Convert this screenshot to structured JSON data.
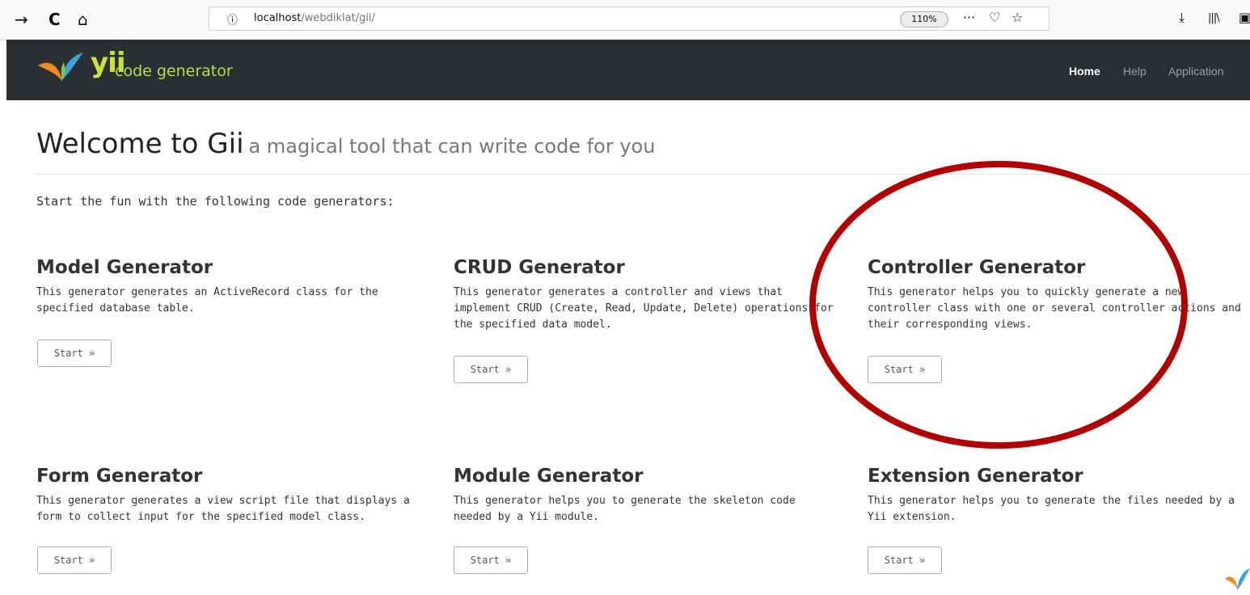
{
  "browser": {
    "back_icon": "→",
    "reload_icon": "C",
    "home_icon": "⌂",
    "info_icon": "ⓘ",
    "url_host": "localhost",
    "url_path": "/webdiklat/gii/",
    "zoom": "110%",
    "more_icon": "···",
    "pocket_icon": "♡",
    "star_icon": "☆",
    "download_icon": "⤓",
    "library_icon": "|||\\",
    "sidebar_icon": "▣"
  },
  "navbar": {
    "brand_logo": "yii",
    "brand_text": "code generator",
    "links": [
      "Home",
      "Help",
      "Application"
    ]
  },
  "welcome": {
    "title": "Welcome to Gii",
    "subtitle": "a magical tool that can write code for you"
  },
  "intro": "Start the fun with the following code generators:",
  "generators": [
    {
      "title": "Model Generator",
      "desc": "This generator generates an ActiveRecord class for the specified database table.",
      "button": "Start »"
    },
    {
      "title": "CRUD Generator",
      "desc": "This generator generates a controller and views that implement CRUD (Create, Read, Update, Delete) operations for the specified data model.",
      "button": "Start »"
    },
    {
      "title": "Controller Generator",
      "desc": "This generator helps you to quickly generate a new controller class with one or several controller actions and their corresponding views.",
      "button": "Start »"
    },
    {
      "title": "Form Generator",
      "desc": "This generator generates a view script file that displays a form to collect input for the specified model class.",
      "button": "Start »"
    },
    {
      "title": "Module Generator",
      "desc": "This generator helps you to generate the skeleton code needed by a Yii module.",
      "button": "Start »"
    },
    {
      "title": "Extension Generator",
      "desc": "This generator helps you to generate the files needed by a Yii extension.",
      "button": "Start »"
    }
  ],
  "colors": {
    "navbar_bg": "#2c2f32",
    "brand_green": "#c8e33f",
    "annotation_red": "#b00000"
  }
}
